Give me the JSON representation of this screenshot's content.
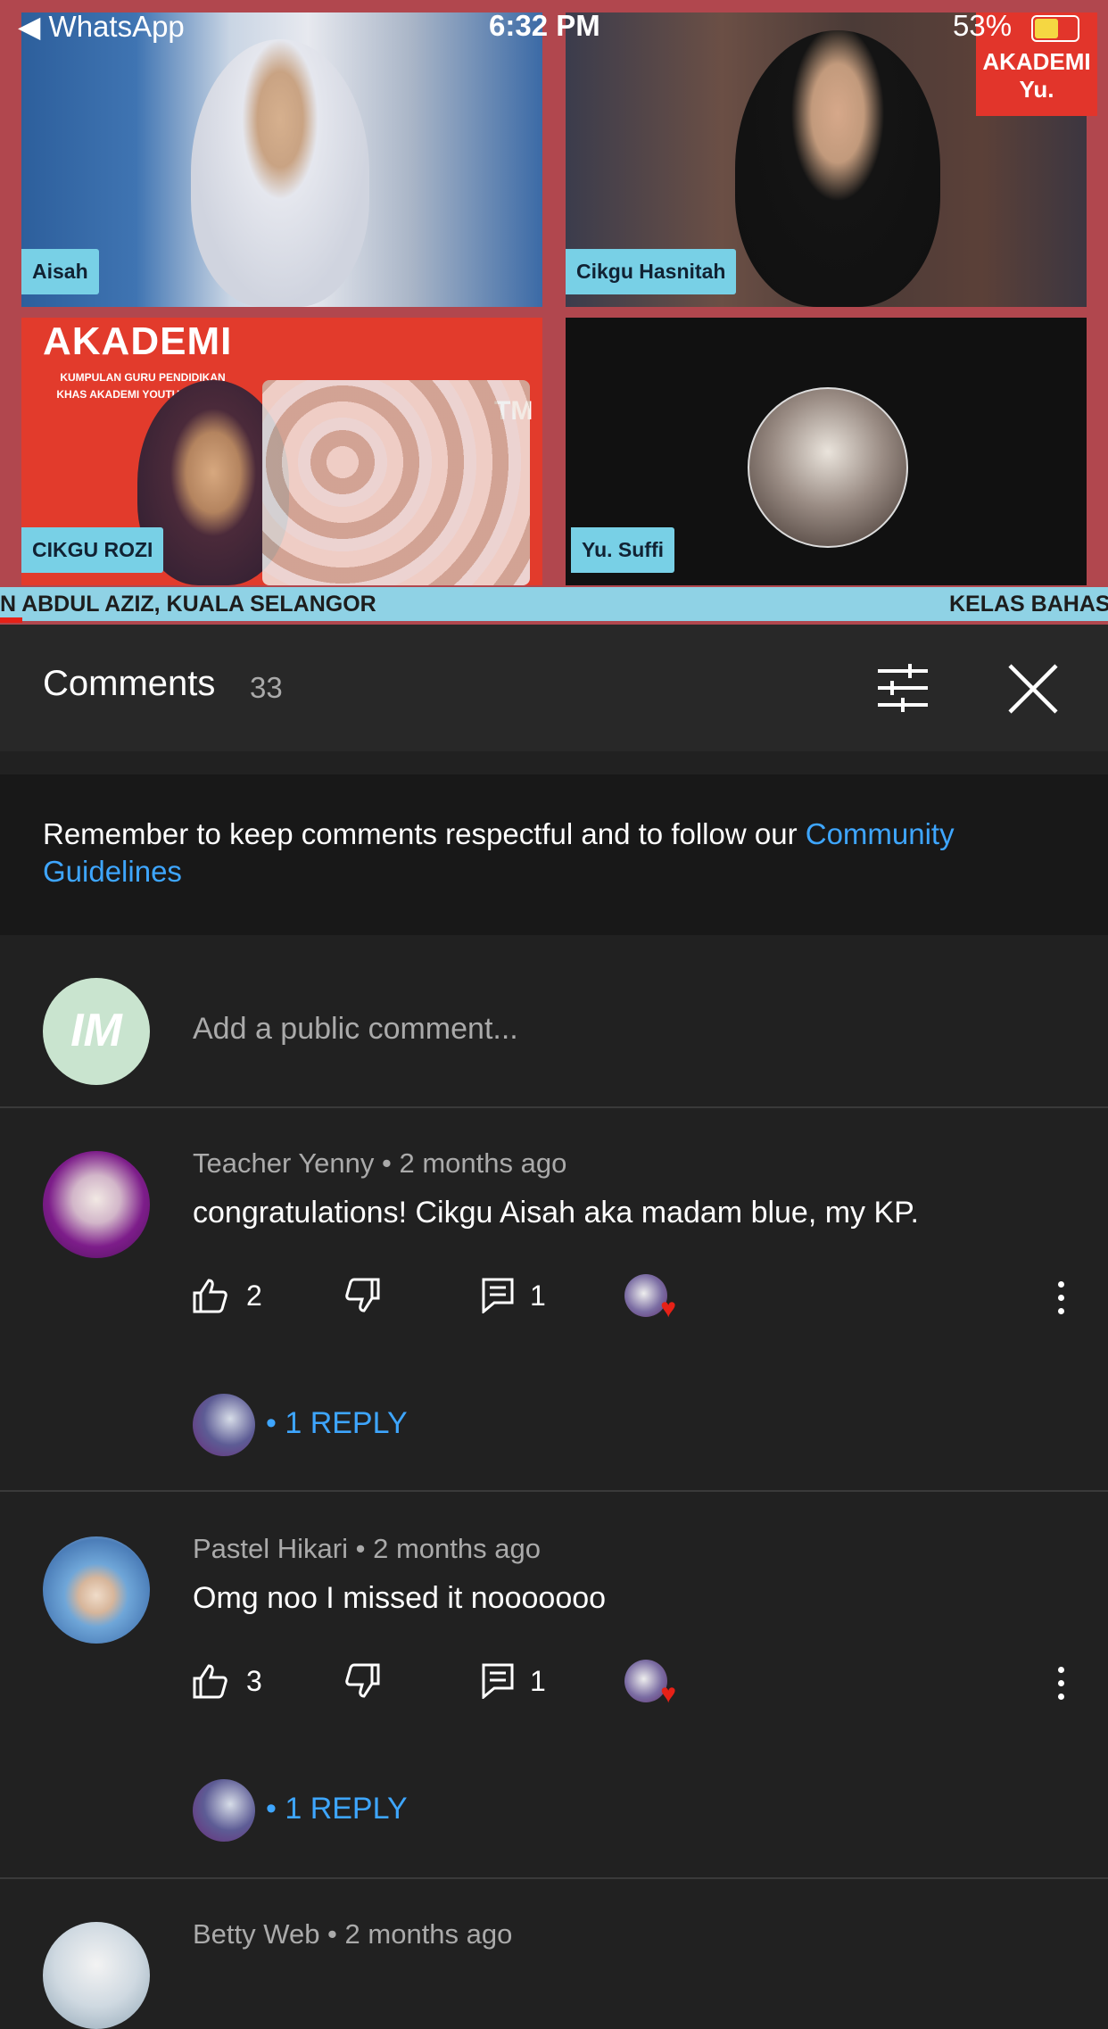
{
  "status_bar": {
    "back_app": "◀ WhatsApp",
    "time": "6:32 PM",
    "battery": "53%"
  },
  "video": {
    "tiles": [
      {
        "name": "Aisah"
      },
      {
        "name": "Cikgu Hasnitah"
      },
      {
        "name": "CIKGU ROZI"
      },
      {
        "name": "Yu. Suffi"
      }
    ],
    "akademi_title": "AKADEMI",
    "akademi_sub": "KUMPULAN GURU PENDIDIKAN KHAS AKADEMI YOUTUBER 2020",
    "tm": "TM",
    "logo": "AKADEMI Yu.",
    "ticker_left": "N ABDUL AZIZ, KUALA SELANGOR",
    "ticker_right": "KELAS BAHAS",
    "progress_fraction": 0.02
  },
  "comments_header": {
    "title": "Comments",
    "count": "33"
  },
  "notice": {
    "text": "Remember to keep comments respectful and to follow our ",
    "link": "Community Guidelines"
  },
  "add_comment": {
    "avatar_initials": "IM",
    "placeholder": "Add a public comment..."
  },
  "comments": [
    {
      "author": "Teacher Yenny",
      "time": "2 months ago",
      "text": "congratulations! Cikgu Aisah aka madam blue, my KP.",
      "likes": "2",
      "replies_count": "1",
      "replies_label": "• 1 REPLY"
    },
    {
      "author": "Pastel Hikari",
      "time": "2 months ago",
      "text": "Omg noo I missed it nooooooo",
      "likes": "3",
      "replies_count": "1",
      "replies_label": "• 1 REPLY"
    },
    {
      "author": "Betty Web",
      "time": "2 months ago"
    }
  ],
  "colors": {
    "background": "#212121",
    "link": "#3ea6ff",
    "progress": "#e62117"
  },
  "icons": [
    "filter-icon",
    "close-icon",
    "like-icon",
    "dislike-icon",
    "reply-icon",
    "more-vert-icon",
    "heart-icon"
  ]
}
